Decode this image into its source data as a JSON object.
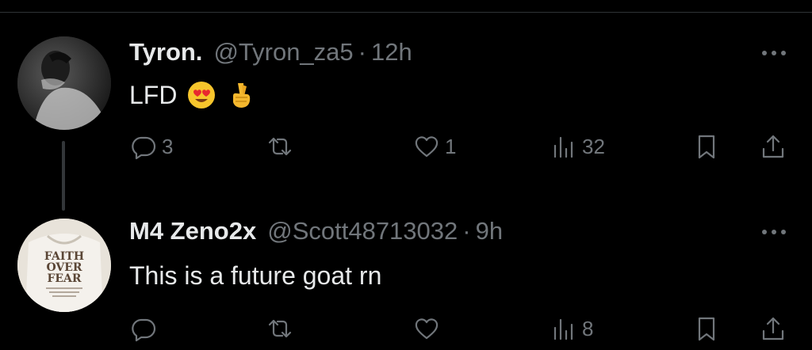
{
  "colors": {
    "background": "#000000",
    "text": "#e7e9ea",
    "muted": "#71767b",
    "divider": "#2f3336"
  },
  "tweets": [
    {
      "name": "Tyron.",
      "handle": "@Tyron_za5",
      "separator": "·",
      "time": "12h",
      "text": "LFD",
      "emojis": [
        "heart-eyes-emoji",
        "crossed-fingers-emoji"
      ],
      "avatar": "person-smoking-avatar",
      "actions": {
        "replies": "3",
        "reposts": "",
        "likes": "1",
        "views": "32"
      }
    },
    {
      "name": "M4 Zeno2x",
      "handle": "@Scott48713032",
      "separator": "·",
      "time": "9h",
      "text": "This is a future goat rn",
      "avatar": "faith-over-fear-hoodie-avatar",
      "actions": {
        "replies": "",
        "reposts": "",
        "likes": "",
        "views": "8"
      }
    }
  ]
}
